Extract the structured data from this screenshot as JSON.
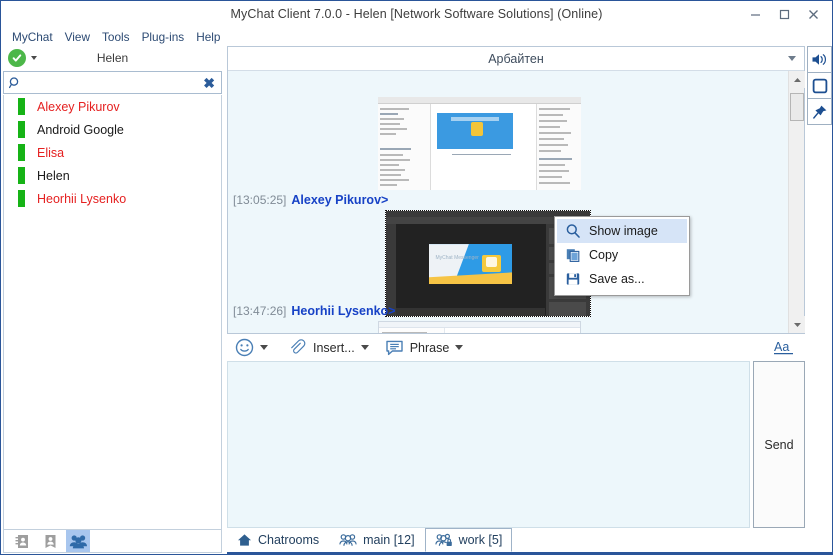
{
  "window": {
    "title": "MyChat Client 7.0.0 - Helen [Network Software Solutions] (Online)",
    "minimize_label": "–",
    "maximize_label": "□",
    "close_label": "✕"
  },
  "menubar": {
    "items": [
      {
        "label": "MyChat"
      },
      {
        "label": "View"
      },
      {
        "label": "Tools"
      },
      {
        "label": "Plug-ins"
      },
      {
        "label": "Help"
      }
    ]
  },
  "sidebar": {
    "self_name": "Helen",
    "status": "online",
    "status_color": "#4cb749",
    "search": {
      "value": "",
      "placeholder": "",
      "clear_label": "✖"
    },
    "contacts": [
      {
        "name": "Alexey Pikurov",
        "color": "#e52121",
        "presence_color": "#16b316"
      },
      {
        "name": "Android Google",
        "color": "#1a1a1a",
        "presence_color": "#16b316"
      },
      {
        "name": "Elisa",
        "color": "#e52121",
        "presence_color": "#16b316"
      },
      {
        "name": "Helen",
        "color": "#1a1a1a",
        "presence_color": "#16b316"
      },
      {
        "name": "Heorhii Lysenko",
        "color": "#e52121",
        "presence_color": "#16b316"
      }
    ],
    "bottom_buttons": [
      {
        "name": "address-book",
        "active": false
      },
      {
        "name": "contact-card",
        "active": false
      },
      {
        "name": "groups",
        "active": true
      }
    ]
  },
  "chat": {
    "header_title": "Арбайтен",
    "messages": [
      {
        "time": "[13:05:25]",
        "author": "Alexey Pikurov>",
        "author_color": "#1742c6"
      },
      {
        "time": "[13:47:26]",
        "author": "Heorhii Lysenko>",
        "author_color": "#1742c6"
      }
    ],
    "attachment_caption": "MyChat Messenger"
  },
  "context_menu": {
    "items": [
      {
        "label": "Show image",
        "icon": "magnifier-icon",
        "selected": true
      },
      {
        "label": "Copy",
        "icon": "copy-icon",
        "selected": false
      },
      {
        "label": "Save as...",
        "icon": "save-icon",
        "selected": false
      }
    ]
  },
  "rail": {
    "buttons": [
      {
        "name": "sound-icon"
      },
      {
        "name": "window-icon"
      },
      {
        "name": "pin-icon"
      }
    ]
  },
  "compose": {
    "emoji_label": "",
    "insert_label": "Insert...",
    "phrase_label": "Phrase",
    "font_label": "Aa",
    "message": {
      "value": "",
      "placeholder": ""
    },
    "send_label": "Send"
  },
  "tabs": [
    {
      "label": "Chatrooms",
      "icon": "home-icon",
      "active": false
    },
    {
      "label": "main [12]",
      "icon": "group-icon",
      "active": false
    },
    {
      "label": "work [5]",
      "icon": "group-lock-icon",
      "active": true
    }
  ]
}
